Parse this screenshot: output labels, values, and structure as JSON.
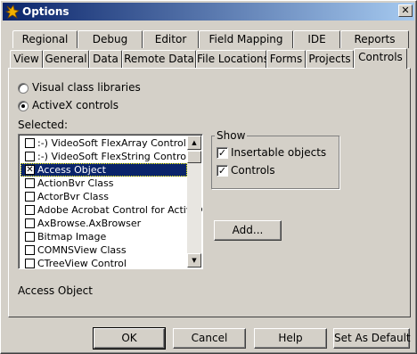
{
  "window": {
    "title": "Options"
  },
  "tabs_row1": [
    "Regional",
    "Debug",
    "Editor",
    "Field Mapping",
    "IDE",
    "Reports"
  ],
  "tabs_row2": [
    "View",
    "General",
    "Data",
    "Remote Data",
    "File Locations",
    "Forms",
    "Projects",
    "Controls"
  ],
  "active_tab": "Controls",
  "radio_group": {
    "options": [
      {
        "label": "Visual class libraries",
        "selected": false
      },
      {
        "label": "ActiveX controls",
        "selected": true
      }
    ]
  },
  "selected_label": "Selected:",
  "list": {
    "items": [
      {
        "label": ":-) VideoSoft FlexArray Control",
        "checked": false
      },
      {
        "label": ":-) VideoSoft FlexString Control",
        "checked": false
      },
      {
        "label": "Access Object",
        "checked": true
      },
      {
        "label": "ActionBvr Class",
        "checked": false
      },
      {
        "label": "ActorBvr Class",
        "checked": false
      },
      {
        "label": "Adobe Acrobat Control for ActiveX",
        "checked": false
      },
      {
        "label": "AxBrowse.AxBrowser",
        "checked": false
      },
      {
        "label": "Bitmap Image",
        "checked": false
      },
      {
        "label": "COMNSView Class",
        "checked": false
      },
      {
        "label": "CTreeView Control",
        "checked": false
      }
    ],
    "highlighted_index": 2
  },
  "show_group": {
    "title": "Show",
    "insertable_label": "Insertable objects",
    "insertable_checked": true,
    "controls_label": "Controls",
    "controls_checked": true
  },
  "add_button": "Add...",
  "status_text": "Access Object",
  "buttons": {
    "ok": "OK",
    "cancel": "Cancel",
    "help": "Help",
    "set_default": "Set As Default"
  }
}
